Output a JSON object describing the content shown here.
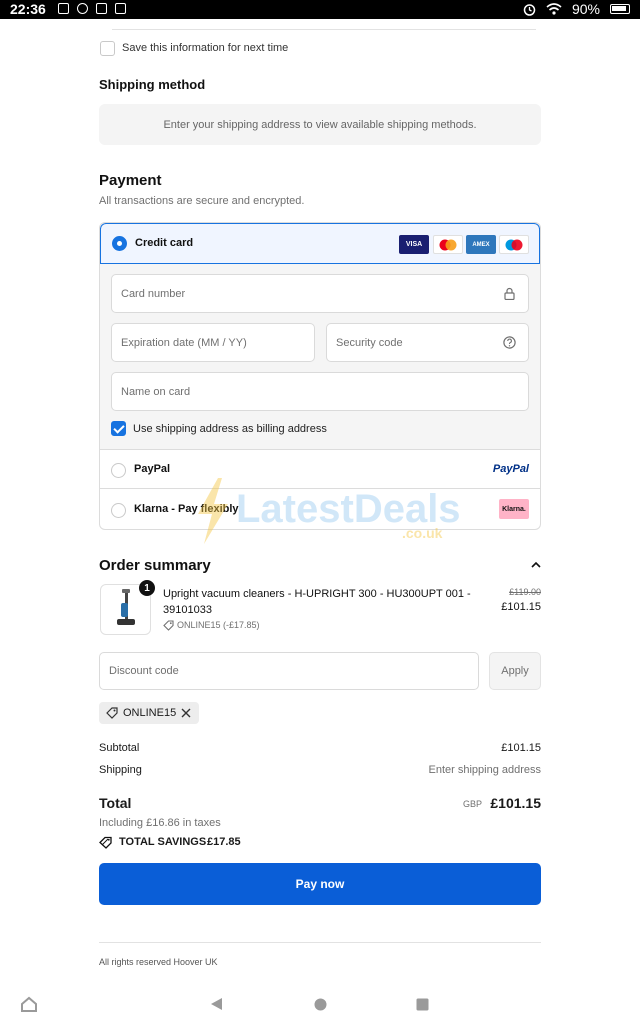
{
  "status_bar": {
    "time": "22:36",
    "battery": "90%"
  },
  "save_info": {
    "label": "Save this information for next time",
    "checked": false
  },
  "shipping_method": {
    "title": "Shipping method",
    "notice": "Enter your shipping address to view available shipping methods."
  },
  "payment": {
    "title": "Payment",
    "subtitle": "All transactions are secure and encrypted.",
    "credit_card": {
      "label": "Credit card",
      "selected": true,
      "logos": [
        "VISA",
        "AMEX"
      ],
      "card_number_placeholder": "Card number",
      "expiration_placeholder": "Expiration date (MM / YY)",
      "security_placeholder": "Security code",
      "name_placeholder": "Name on card",
      "billing_label": "Use shipping address as billing address",
      "billing_checked": true
    },
    "paypal": {
      "label": "PayPal",
      "logo_text": "PayPal"
    },
    "klarna": {
      "label": "Klarna - Pay flexibly",
      "logo_text": "Klarna."
    }
  },
  "watermark": {
    "brand": "LatestDeals",
    "suffix": ".co.uk"
  },
  "order_summary": {
    "title": "Order summary",
    "item": {
      "quantity": "1",
      "name": "Upright vacuum cleaners - H-UPRIGHT 300 - HU300UPT 001 - 39101033",
      "discount": "ONLINE15 (-£17.85)",
      "original_price": "£119.00",
      "price": "£101.15"
    },
    "discount_placeholder": "Discount code",
    "apply_label": "Apply",
    "applied_code": "ONLINE15",
    "subtotal_label": "Subtotal",
    "subtotal_value": "£101.15",
    "shipping_label": "Shipping",
    "shipping_value": "Enter shipping address",
    "total_label": "Total",
    "currency": "GBP",
    "total_value": "£101.15",
    "taxes": "Including £16.86 in taxes",
    "savings_label": "TOTAL SAVINGS",
    "savings_value": "£17.85"
  },
  "pay_now_label": "Pay now",
  "footer": "All rights reserved Hoover UK",
  "colors": {
    "accent": "#0a5ed7",
    "selected": "#1773e0"
  }
}
